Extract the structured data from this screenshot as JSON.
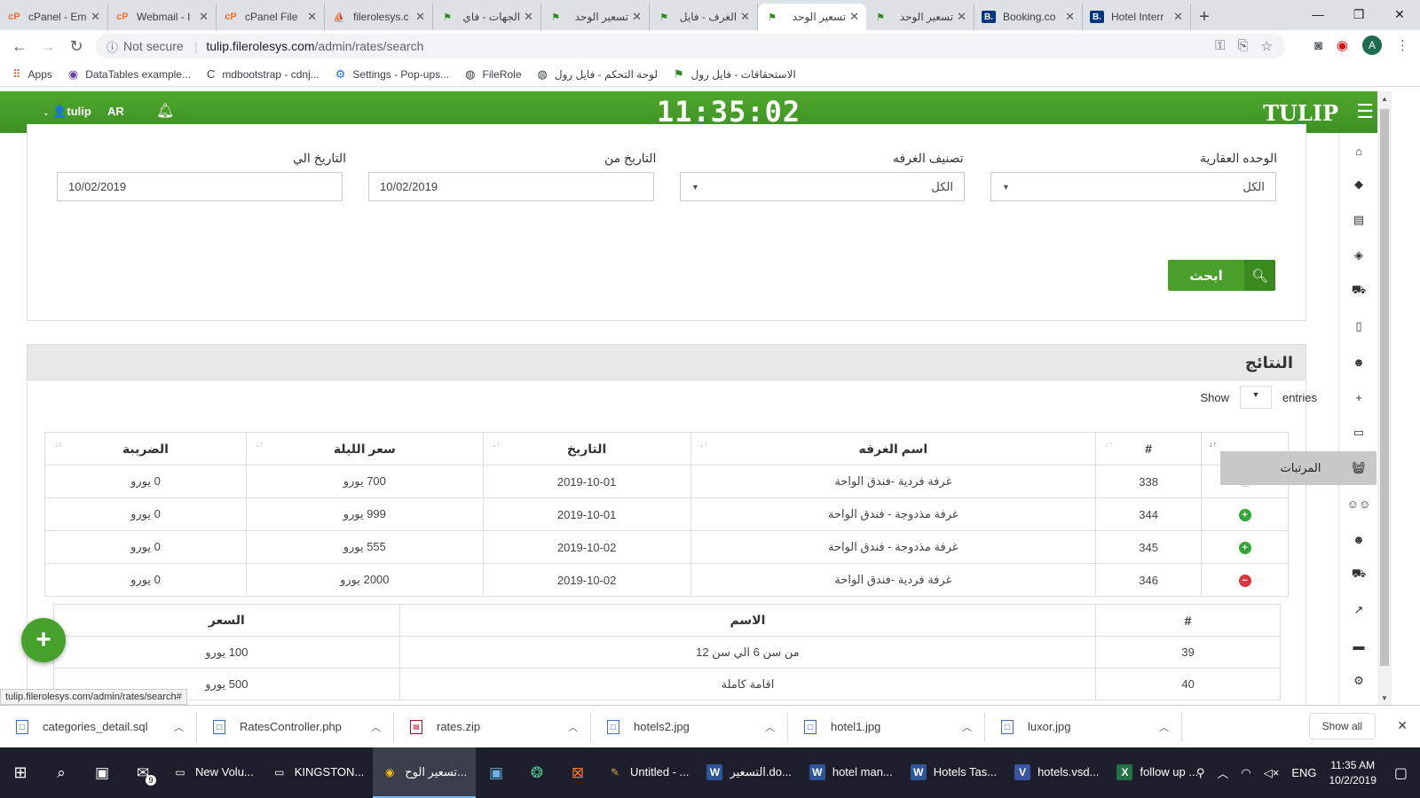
{
  "browser": {
    "tabs": [
      {
        "title": "cPanel - Em",
        "icon": "cpanel-icon",
        "active": false
      },
      {
        "title": "Webmail - I",
        "icon": "cpanel-icon",
        "active": false
      },
      {
        "title": "cPanel File",
        "icon": "cpanel-icon",
        "active": false
      },
      {
        "title": "filerolesys.c",
        "icon": "phpmyadmin-icon",
        "active": false
      },
      {
        "title": "الجهات - فاي",
        "icon": "filerole-icon",
        "active": false
      },
      {
        "title": "تسعير الوحد",
        "icon": "filerole-icon",
        "active": false
      },
      {
        "title": "الغرف - فايل",
        "icon": "filerole-icon",
        "active": false
      },
      {
        "title": "تسعير الوحد",
        "icon": "filerole-icon",
        "active": true
      },
      {
        "title": "تسعير الوحد",
        "icon": "filerole-icon",
        "active": false
      },
      {
        "title": "Booking.co",
        "icon": "booking-icon",
        "active": false
      },
      {
        "title": "Hotel Interr",
        "icon": "booking-icon",
        "active": false
      }
    ],
    "security": "Not secure",
    "url_host": "tulip.filerolesys.com",
    "url_path": "/admin/rates/search",
    "bookmarks": [
      {
        "label": "Apps",
        "icon": "apps-grid-icon"
      },
      {
        "label": "DataTables example...",
        "icon": "globe-icon"
      },
      {
        "label": "mdbootstrap - cdnj...",
        "icon": "c-icon"
      },
      {
        "label": "Settings - Pop-ups...",
        "icon": "gear-icon"
      },
      {
        "label": "FileRole",
        "icon": "globe-icon"
      },
      {
        "label": "لوحة التحكم - فايل رول",
        "icon": "globe-icon"
      },
      {
        "label": "الاستحقاقات - فايل رول",
        "icon": "filerole-icon"
      }
    ],
    "avatar_letter": "A"
  },
  "app": {
    "username": "tulip",
    "lang": "AR",
    "clock": "11:35:02",
    "brand": "TULIP"
  },
  "filters": {
    "unit_label": "الوحده العقارية",
    "unit_value": "الكل",
    "room_class_label": "تصنيف الغرفه",
    "room_class_value": "الكل",
    "date_from_label": "التاريخ من",
    "date_from_value": "10/02/2019",
    "date_to_label": "التاريخ الي",
    "date_to_value": "10/02/2019",
    "search_label": "ابحث"
  },
  "results": {
    "title": "النتائج",
    "show_label": "Show",
    "entries_label": "entries",
    "headers": {
      "num": "#",
      "room_name": "اسم الغرفه",
      "date": "التاريخ",
      "night_price": "سعر الليلة",
      "tax": "الضريبة"
    },
    "rows": [
      {
        "status": "empty",
        "num": "338",
        "room_name": "غرفة فردية -فندق الواحة",
        "date": "2019-10-01",
        "night_price": "700 يورو",
        "tax": "0 يورو"
      },
      {
        "status": "plus",
        "num": "344",
        "room_name": "غرفة مذدوجة - فندق الواحة",
        "date": "2019-10-01",
        "night_price": "999 يورو",
        "tax": "0 يورو"
      },
      {
        "status": "plus",
        "num": "345",
        "room_name": "غرفة مذدوجة - فندق الواحة",
        "date": "2019-10-02",
        "night_price": "555 يورو",
        "tax": "0 يورو"
      },
      {
        "status": "minus",
        "num": "346",
        "room_name": "غرفة فردية -فندق الواحة",
        "date": "2019-10-02",
        "night_price": "2000 يورو",
        "tax": "0 يورو"
      }
    ],
    "sub_headers": {
      "num": "#",
      "name": "الاسم",
      "price": "السعر"
    },
    "sub_rows": [
      {
        "num": "39",
        "name": "من سن 6 الي سن 12",
        "price": "100 يورو"
      },
      {
        "num": "40",
        "name": "اقامة كاملة",
        "price": "500 يورو"
      }
    ]
  },
  "sidebar": {
    "tooltip": "المرتبات",
    "icons": [
      "home-icon",
      "tag-icon",
      "document-icon",
      "tags-icon",
      "cart-icon",
      "file-icon",
      "user-edit-icon",
      "plus-icon",
      "inbox-icon",
      "basket-icon",
      "users-icon",
      "user-edit-icon",
      "cart-icon",
      "chart-icon",
      "card-icon",
      "gear-icon"
    ]
  },
  "status_url": "tulip.filerolesys.com/admin/rates/search#",
  "downloads": {
    "items": [
      "categories_detail.sql",
      "RatesController.php",
      "rates.zip",
      "hotels2.jpg",
      "hotel1.jpg",
      "luxor.jpg"
    ],
    "show_all": "Show all"
  },
  "taskbar": {
    "apps": [
      {
        "label": "New Volu...",
        "icon": "drive-icon",
        "active": false
      },
      {
        "label": "KINGSTON...",
        "icon": "drive-icon",
        "active": false
      },
      {
        "label": "تسعير الوح...",
        "icon": "chrome-icon",
        "active": true
      },
      {
        "label": "",
        "icon": "app-icon",
        "active": false
      },
      {
        "label": "",
        "icon": "globe-icon",
        "active": false
      },
      {
        "label": "",
        "icon": "xampp-icon",
        "active": false
      },
      {
        "label": "Untitled - ...",
        "icon": "paint-icon",
        "active": false
      },
      {
        "label": "التسعير.do...",
        "icon": "word-icon",
        "active": false
      },
      {
        "label": "hotel man...",
        "icon": "word-icon",
        "active": false
      },
      {
        "label": "Hotels Tas...",
        "icon": "word-icon",
        "active": false
      },
      {
        "label": "hotels.vsd...",
        "icon": "visio-icon",
        "active": false
      },
      {
        "label": "follow up ...",
        "icon": "excel-icon",
        "active": false
      }
    ],
    "lang": "ENG",
    "time": "11:35 AM",
    "date": "10/2/2019",
    "mail_badge": "9"
  }
}
